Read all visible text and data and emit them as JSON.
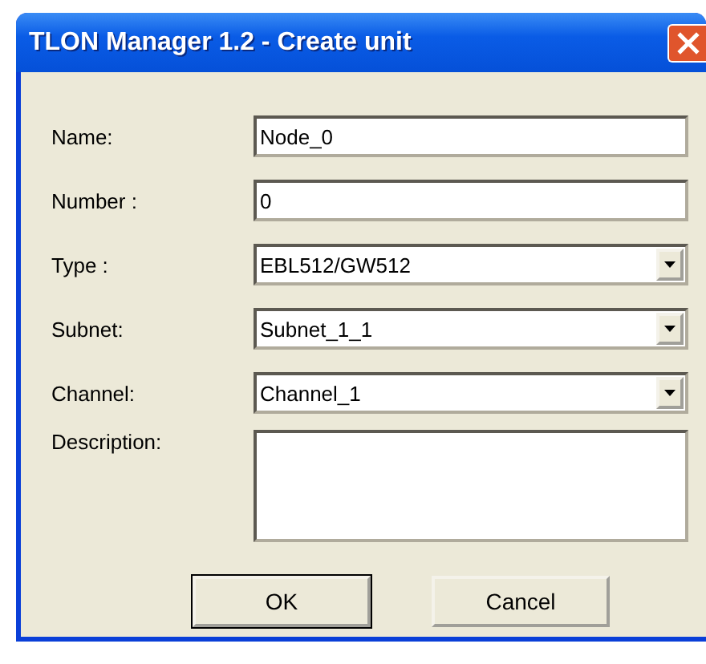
{
  "window": {
    "title": "TLON Manager 1.2 - Create unit"
  },
  "fields": [
    {
      "kind": "text",
      "label": "Name:",
      "value": "Node_0"
    },
    {
      "kind": "text",
      "label": "Number :",
      "value": "0"
    },
    {
      "kind": "dropdown",
      "label": "Type :",
      "value": "EBL512/GW512"
    },
    {
      "kind": "dropdown",
      "label": "Subnet:",
      "value": "Subnet_1_1"
    },
    {
      "kind": "dropdown",
      "label": "Channel:",
      "value": "Channel_1"
    },
    {
      "kind": "textarea",
      "label": "Description:"
    }
  ],
  "buttons": [
    {
      "label": "OK",
      "default": true
    },
    {
      "label": "Cancel",
      "default": false
    }
  ]
}
